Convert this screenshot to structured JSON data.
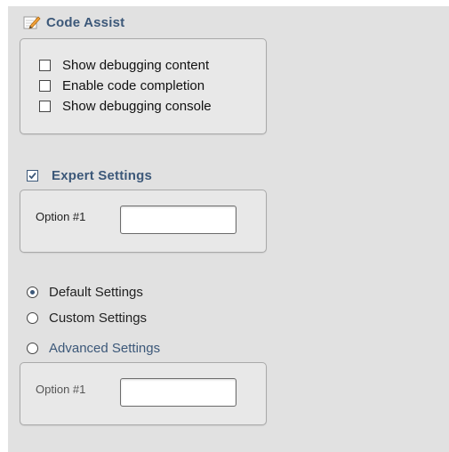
{
  "code_assist": {
    "title": "Code Assist",
    "icon": "pencil-icon",
    "options": [
      {
        "label": "Show debugging content",
        "checked": false
      },
      {
        "label": "Enable code completion",
        "checked": false
      },
      {
        "label": "Show debugging console",
        "checked": false
      }
    ]
  },
  "expert_settings": {
    "title": "Expert Settings",
    "checked": true,
    "field_label": "Option #1",
    "field_value": ""
  },
  "settings_mode": {
    "options": [
      {
        "label": "Default Settings",
        "selected": true
      },
      {
        "label": "Custom Settings",
        "selected": false
      },
      {
        "label": "Advanced Settings",
        "selected": false
      }
    ],
    "field_label": "Option #1",
    "field_value": ""
  },
  "colors": {
    "panel_bg": "#e1e1e1",
    "group_bg": "#e8e8e8",
    "accent": "#3c5879"
  }
}
